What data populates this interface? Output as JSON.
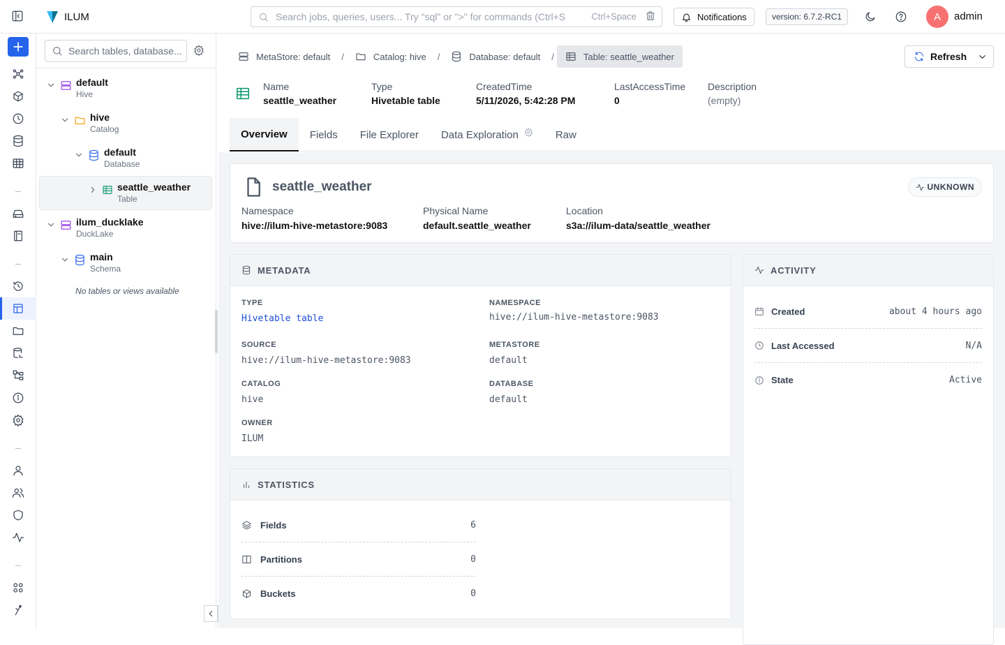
{
  "app": {
    "name": "ILUM",
    "version": "version: 6.7.2-RC1",
    "user": "admin",
    "avatar_letter": "A"
  },
  "search": {
    "placeholder": "Search jobs, queries, users... Try \"sql\" or \">\" for commands (Ctrl+S",
    "shortcut": "Ctrl+Space"
  },
  "notifications_label": "Notifications",
  "tree": {
    "search_placeholder": "Search tables, database...",
    "nodes": [
      {
        "name": "default",
        "type": "Hive"
      },
      {
        "name": "hive",
        "type": "Catalog"
      },
      {
        "name": "default",
        "type": "Database"
      },
      {
        "name": "seattle_weather",
        "type": "Table"
      },
      {
        "name": "ilum_ducklake",
        "type": "DuckLake"
      },
      {
        "name": "main",
        "type": "Schema"
      }
    ],
    "empty_message": "No tables or views available"
  },
  "breadcrumb": [
    "MetaStore: default",
    "Catalog: hive",
    "Database: default",
    "Table: seattle_weather"
  ],
  "refresh_label": "Refresh",
  "summary": [
    {
      "label": "Name",
      "value": "seattle_weather"
    },
    {
      "label": "Type",
      "value": "Hivetable table"
    },
    {
      "label": "CreatedTime",
      "value": "5/11/2026, 5:42:28 PM"
    },
    {
      "label": "LastAccessTime",
      "value": "0"
    },
    {
      "label": "Description",
      "value": "(empty)"
    }
  ],
  "tabs": [
    "Overview",
    "Fields",
    "File Explorer",
    "Data Exploration",
    "Raw"
  ],
  "overview": {
    "name": "seattle_weather",
    "status": "UNKNOWN",
    "fields": [
      {
        "label": "Namespace",
        "value": "hive://ilum-hive-metastore:9083"
      },
      {
        "label": "Physical Name",
        "value": "default.seattle_weather"
      },
      {
        "label": "Location",
        "value": "s3a://ilum-data/seattle_weather"
      }
    ]
  },
  "metadata": {
    "title": "METADATA",
    "items": [
      {
        "label": "TYPE",
        "value": "Hivetable table"
      },
      {
        "label": "NAMESPACE",
        "value": "hive://ilum-hive-metastore:9083"
      },
      {
        "label": "SOURCE",
        "value": "hive://ilum-hive-metastore:9083"
      },
      {
        "label": "METASTORE",
        "value": "default"
      },
      {
        "label": "CATALOG",
        "value": "hive"
      },
      {
        "label": "DATABASE",
        "value": "default"
      },
      {
        "label": "OWNER",
        "value": "ILUM"
      }
    ]
  },
  "activity": {
    "title": "ACTIVITY",
    "rows": [
      {
        "label": "Created",
        "value": "about 4 hours ago",
        "icon": "calendar-icon"
      },
      {
        "label": "Last Accessed",
        "value": "N/A",
        "icon": "clock-icon"
      },
      {
        "label": "State",
        "value": "Active",
        "icon": "info-icon"
      }
    ]
  },
  "statistics": {
    "title": "STATISTICS",
    "rows": [
      {
        "label": "Fields",
        "value": "6",
        "icon": "layers-icon"
      },
      {
        "label": "Partitions",
        "value": "0",
        "icon": "columns-icon"
      },
      {
        "label": "Buckets",
        "value": "0",
        "icon": "box-icon"
      }
    ]
  },
  "colors": {
    "accent": "#2563eb",
    "table_icon": "#059669",
    "hive_icon": "#9333ea",
    "folder_icon": "#f59e0b",
    "database_icon": "#2563eb"
  }
}
